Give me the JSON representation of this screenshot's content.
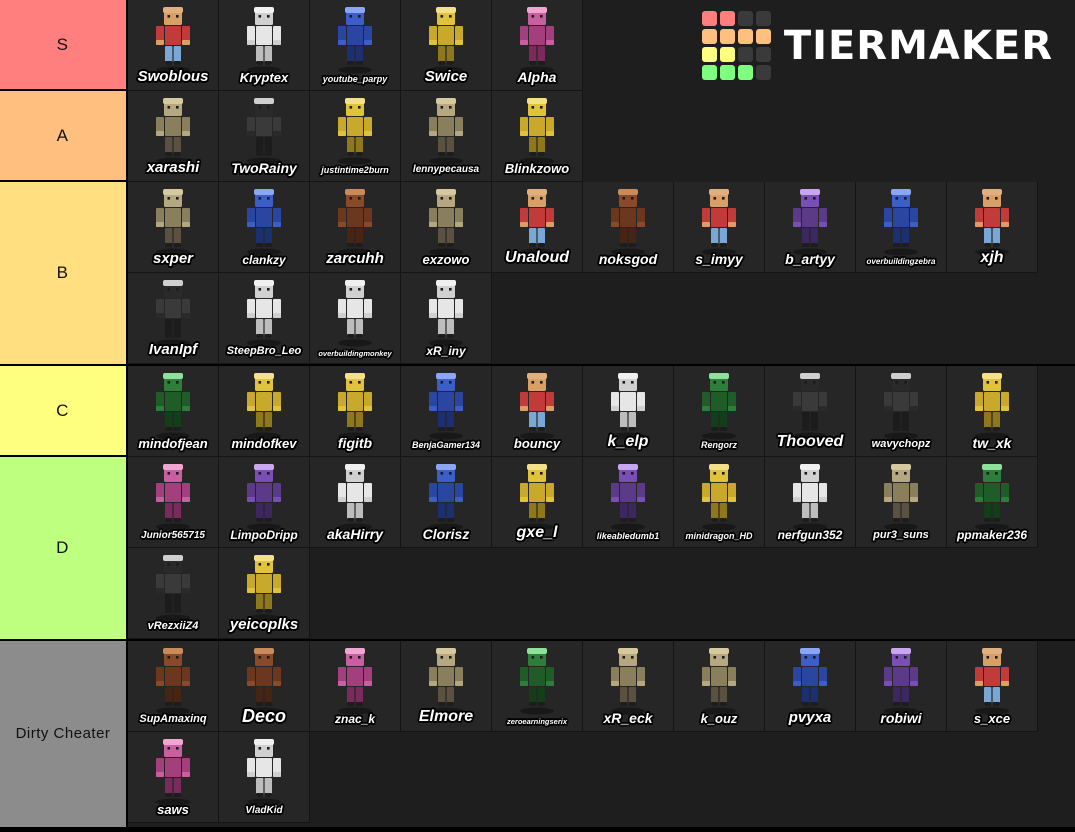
{
  "app": {
    "brand": "TIERMAKER",
    "logo_colors": [
      "#ff7f7f",
      "#ff7f7f",
      "#3a3a3a",
      "#3a3a3a",
      "#ffbf7f",
      "#ffbf7f",
      "#ffbf7f",
      "#ffbf7f",
      "#ffff7f",
      "#ffff7f",
      "#3a3a3a",
      "#3a3a3a",
      "#7fff7f",
      "#7fff7f",
      "#7fff7f",
      "#3a3a3a"
    ]
  },
  "tiers": [
    {
      "label": "S",
      "color": "#ff7f7f",
      "height": 91,
      "items": [
        {
          "name": "Swoblous",
          "size": 15
        },
        {
          "name": "Kryptex",
          "size": 13
        },
        {
          "name": "youtube_parpy",
          "size": 9
        },
        {
          "name": "Swice",
          "size": 15
        },
        {
          "name": "Alpha",
          "size": 14
        }
      ]
    },
    {
      "label": "A",
      "color": "#ffbf7f",
      "height": 91,
      "items": [
        {
          "name": "xarashi",
          "size": 15
        },
        {
          "name": "TwoRainy",
          "size": 14
        },
        {
          "name": "justintime2burn",
          "size": 9
        },
        {
          "name": "lennypecausa",
          "size": 10
        },
        {
          "name": "Blinkzowo",
          "size": 13
        }
      ]
    },
    {
      "label": "B",
      "color": "#ffdf80",
      "height": 184,
      "items": [
        {
          "name": "sxper",
          "size": 15
        },
        {
          "name": "clankzy",
          "size": 12
        },
        {
          "name": "zarcuhh",
          "size": 15
        },
        {
          "name": "exzowo",
          "size": 13
        },
        {
          "name": "Unaloud",
          "size": 16
        },
        {
          "name": "noksgod",
          "size": 14
        },
        {
          "name": "s_imyy",
          "size": 14
        },
        {
          "name": "b_artyy",
          "size": 14
        },
        {
          "name": "overbuildingzebra",
          "size": 8
        },
        {
          "name": "xjh",
          "size": 16
        },
        {
          "name": "IvanIpf",
          "size": 15
        },
        {
          "name": "SteepBro_Leo",
          "size": 11
        },
        {
          "name": "overbuildingmonkey",
          "size": 7.5
        },
        {
          "name": "xR_iny",
          "size": 12
        }
      ]
    },
    {
      "label": "C",
      "color": "#ffff7f",
      "height": 91,
      "items": [
        {
          "name": "mindofjean",
          "size": 13
        },
        {
          "name": "mindofkev",
          "size": 13
        },
        {
          "name": "figitb",
          "size": 14
        },
        {
          "name": "BenjaGamer134",
          "size": 9
        },
        {
          "name": "bouncy",
          "size": 13
        },
        {
          "name": "k_elp",
          "size": 16
        },
        {
          "name": "Rengorz",
          "size": 9
        },
        {
          "name": "Thooved",
          "size": 16
        },
        {
          "name": "wavychopz",
          "size": 11
        },
        {
          "name": "tw_xk",
          "size": 14
        }
      ]
    },
    {
      "label": "D",
      "color": "#bfff7f",
      "height": 184,
      "items": [
        {
          "name": "Junior565715",
          "size": 10
        },
        {
          "name": "LimpoDripp",
          "size": 12
        },
        {
          "name": "akaHirry",
          "size": 14
        },
        {
          "name": "Clorisz",
          "size": 14
        },
        {
          "name": "gxe_l",
          "size": 16
        },
        {
          "name": "likeabledumb1",
          "size": 9
        },
        {
          "name": "minidragon_HD",
          "size": 9
        },
        {
          "name": "nerfgun352",
          "size": 12
        },
        {
          "name": "pur3_suns",
          "size": 11
        },
        {
          "name": "ppmaker236",
          "size": 12
        },
        {
          "name": "vRezxiiZ4",
          "size": 11
        },
        {
          "name": "yeicoplks",
          "size": 15
        }
      ]
    },
    {
      "label": "Dirty Cheater",
      "color": "#8c8c8c",
      "height": 186,
      "items": [
        {
          "name": "SupAmaxinq",
          "size": 11
        },
        {
          "name": "Deco",
          "size": 18
        },
        {
          "name": "znac_k",
          "size": 12
        },
        {
          "name": "Elmore",
          "size": 16
        },
        {
          "name": "zeroearningserix",
          "size": 7.5
        },
        {
          "name": "xR_eck",
          "size": 14
        },
        {
          "name": "k_ouz",
          "size": 13
        },
        {
          "name": "pvyxa",
          "size": 15
        },
        {
          "name": "robiwi",
          "size": 14
        },
        {
          "name": "s_xce",
          "size": 13
        },
        {
          "name": "saws",
          "size": 13
        },
        {
          "name": "VladKid",
          "size": 10
        }
      ]
    }
  ]
}
